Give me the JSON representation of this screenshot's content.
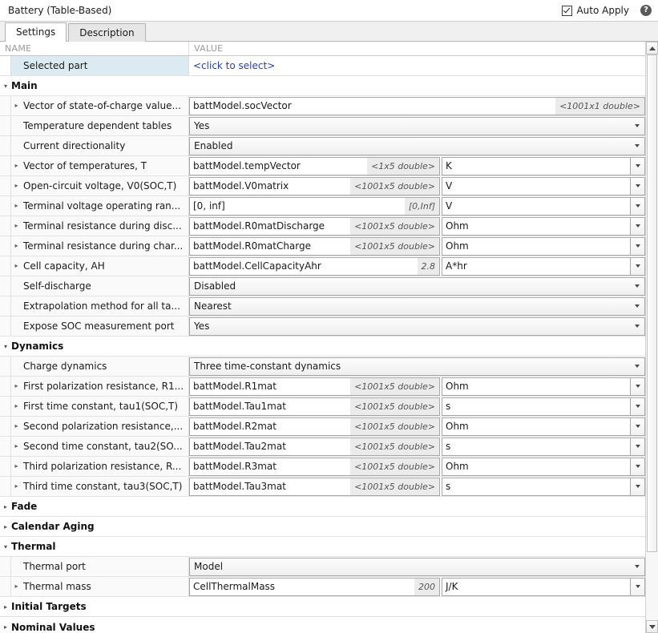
{
  "window": {
    "title": "Battery (Table-Based)",
    "auto_apply_label": "Auto Apply",
    "auto_apply_checked": true,
    "help_glyph": "?"
  },
  "tabs": [
    {
      "label": "Settings",
      "active": true
    },
    {
      "label": "Description",
      "active": false
    }
  ],
  "columns": {
    "name": "NAME",
    "value": "VALUE"
  },
  "selected_row": {
    "name": "Selected part",
    "value": "<click to select>"
  },
  "colors": {
    "selection": "#dcebf2",
    "link": "#2b3fa0",
    "hint_bg": "#ebebeb",
    "header_text": "#9a9a9a"
  },
  "sections": [
    {
      "label": "Main",
      "expanded": true,
      "rows": [
        {
          "name": "Vector of state-of-charge value...",
          "expandable": true,
          "widget": "text",
          "value": "battModel.socVector",
          "hint": "<1001x1 double>",
          "unit": null
        },
        {
          "name": "Temperature dependent tables",
          "expandable": false,
          "widget": "combo",
          "value": "Yes"
        },
        {
          "name": "Current directionality",
          "expandable": false,
          "widget": "combo",
          "value": "Enabled"
        },
        {
          "name": "Vector of temperatures, T",
          "expandable": true,
          "widget": "text",
          "value": "battModel.tempVector",
          "hint": "<1x5 double>",
          "unit": "K"
        },
        {
          "name": "Open-circuit voltage, V0(SOC,T)",
          "expandable": true,
          "widget": "text",
          "value": "battModel.V0matrix",
          "hint": "<1001x5 double>",
          "unit": "V"
        },
        {
          "name": "Terminal voltage operating ran...",
          "expandable": true,
          "widget": "text",
          "value": "[0, inf]",
          "hint": "[0,Inf]",
          "unit": "V"
        },
        {
          "name": "Terminal resistance during disc...",
          "expandable": true,
          "widget": "text",
          "value": "battModel.R0matDischarge",
          "hint": "<1001x5 double>",
          "unit": "Ohm"
        },
        {
          "name": "Terminal resistance during char...",
          "expandable": true,
          "widget": "text",
          "value": "battModel.R0matCharge",
          "hint": "<1001x5 double>",
          "unit": "Ohm"
        },
        {
          "name": "Cell capacity, AH",
          "expandable": true,
          "widget": "text",
          "value": "battModel.CellCapacityAhr",
          "hint": "2.8",
          "unit": "A*hr"
        },
        {
          "name": "Self-discharge",
          "expandable": false,
          "widget": "combo",
          "value": "Disabled"
        },
        {
          "name": "Extrapolation method for all ta...",
          "expandable": false,
          "widget": "combo",
          "value": "Nearest"
        },
        {
          "name": "Expose SOC measurement port",
          "expandable": false,
          "widget": "combo",
          "value": "Yes"
        }
      ]
    },
    {
      "label": "Dynamics",
      "expanded": true,
      "rows": [
        {
          "name": "Charge dynamics",
          "expandable": false,
          "widget": "combo",
          "value": "Three time-constant dynamics"
        },
        {
          "name": "First polarization resistance, R1...",
          "expandable": true,
          "widget": "text",
          "value": "battModel.R1mat",
          "hint": "<1001x5 double>",
          "unit": "Ohm"
        },
        {
          "name": "First time constant, tau1(SOC,T)",
          "expandable": true,
          "widget": "text",
          "value": "battModel.Tau1mat",
          "hint": "<1001x5 double>",
          "unit": "s"
        },
        {
          "name": "Second polarization resistance,...",
          "expandable": true,
          "widget": "text",
          "value": "battModel.R2mat",
          "hint": "<1001x5 double>",
          "unit": "Ohm"
        },
        {
          "name": "Second time constant, tau2(SO...",
          "expandable": true,
          "widget": "text",
          "value": "battModel.Tau2mat",
          "hint": "<1001x5 double>",
          "unit": "s"
        },
        {
          "name": "Third polarization resistance, R...",
          "expandable": true,
          "widget": "text",
          "value": "battModel.R3mat",
          "hint": "<1001x5 double>",
          "unit": "Ohm"
        },
        {
          "name": "Third time constant, tau3(SOC,T)",
          "expandable": true,
          "widget": "text",
          "value": "battModel.Tau3mat",
          "hint": "<1001x5 double>",
          "unit": "s"
        }
      ]
    },
    {
      "label": "Fade",
      "expanded": false,
      "rows": []
    },
    {
      "label": "Calendar Aging",
      "expanded": false,
      "rows": []
    },
    {
      "label": "Thermal",
      "expanded": true,
      "rows": [
        {
          "name": "Thermal port",
          "expandable": false,
          "widget": "combo",
          "value": "Model"
        },
        {
          "name": "Thermal mass",
          "expandable": true,
          "widget": "text",
          "value": "CellThermalMass",
          "hint": "200",
          "unit": "J/K"
        }
      ]
    },
    {
      "label": "Initial Targets",
      "expanded": false,
      "rows": []
    },
    {
      "label": "Nominal Values",
      "expanded": false,
      "rows": [],
      "clipped": true
    }
  ],
  "glyphs": {
    "expanded": "▾",
    "collapsed": "▸"
  }
}
